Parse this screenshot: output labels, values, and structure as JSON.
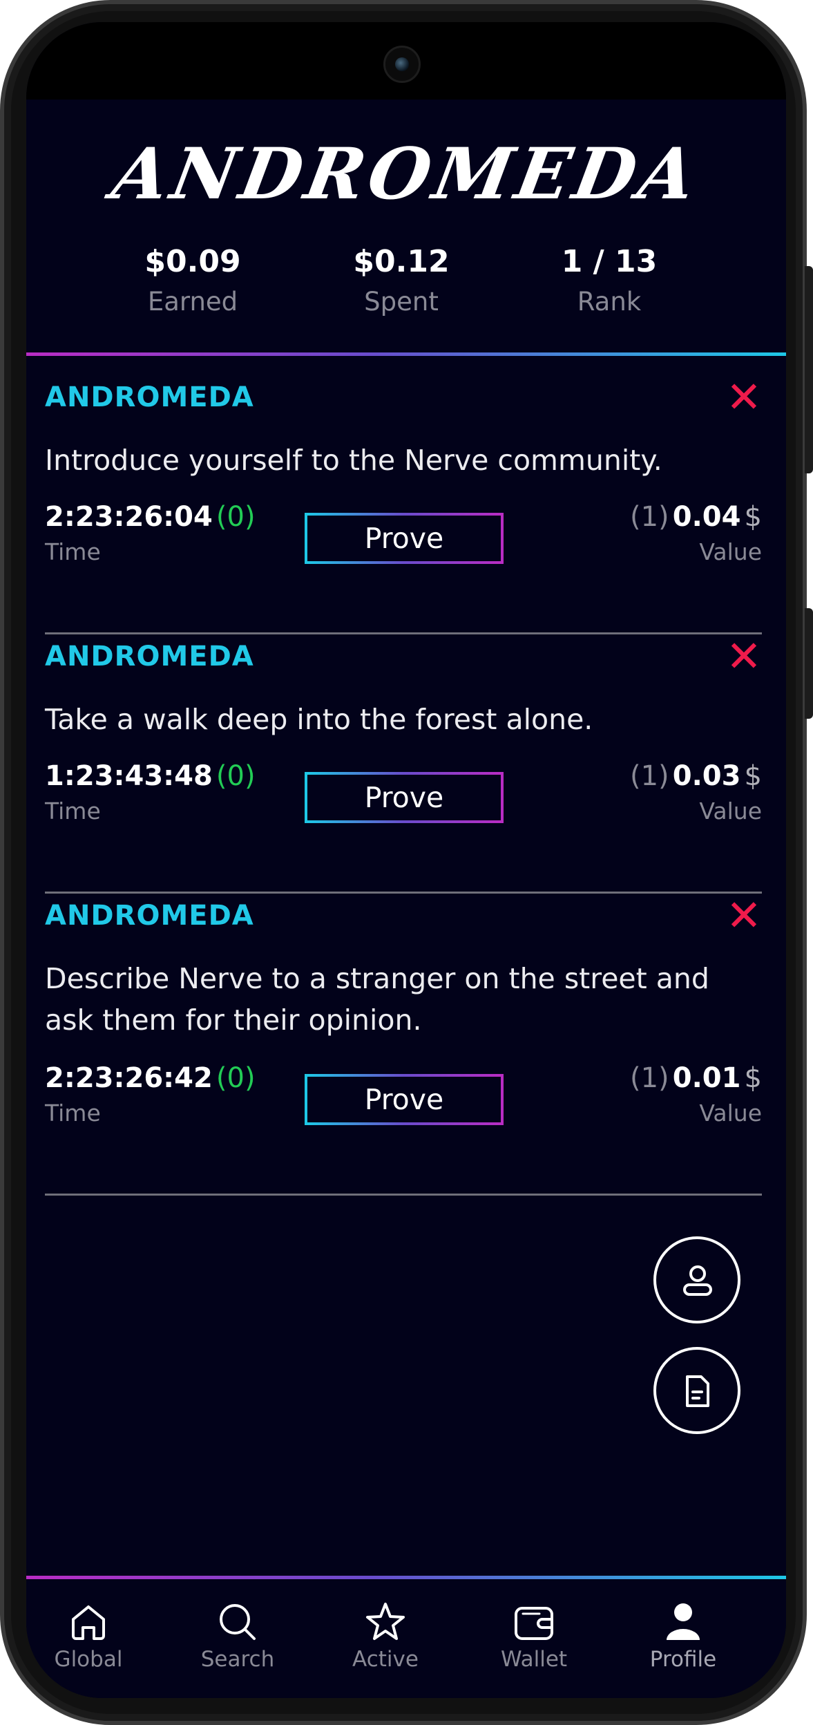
{
  "header": {
    "logo_text": "ANDROMEDA",
    "stats": [
      {
        "value": "$0.09",
        "label": "Earned"
      },
      {
        "value": "$0.12",
        "label": "Spent"
      },
      {
        "value": "1 / 13",
        "label": "Rank"
      }
    ]
  },
  "tasks": [
    {
      "author": "ANDROMEDA",
      "close_symbol": "✕",
      "description": "Introduce yourself to the Nerve community.",
      "time": "2:23:26:04",
      "time_count": "(0)",
      "time_label": "Time",
      "prove_label": "Prove",
      "value_count": "(1)",
      "value_amount": "0.04",
      "currency": "$",
      "value_label": "Value"
    },
    {
      "author": "ANDROMEDA",
      "close_symbol": "✕",
      "description": "Take a walk deep into the forest alone.",
      "time": "1:23:43:48",
      "time_count": "(0)",
      "time_label": "Time",
      "prove_label": "Prove",
      "value_count": "(1)",
      "value_amount": "0.03",
      "currency": "$",
      "value_label": "Value"
    },
    {
      "author": "ANDROMEDA",
      "close_symbol": "✕",
      "description": "Describe Nerve to a stranger on the street and ask them for their opinion.",
      "time": "2:23:26:42",
      "time_count": "(0)",
      "time_label": "Time",
      "prove_label": "Prove",
      "value_count": "(1)",
      "value_amount": "0.01",
      "currency": "$",
      "value_label": "Value"
    }
  ],
  "fabs": [
    {
      "icon": "user-icon"
    },
    {
      "icon": "document-icon"
    }
  ],
  "nav": [
    {
      "label": "Global",
      "icon": "home-icon"
    },
    {
      "label": "Search",
      "icon": "search-icon"
    },
    {
      "label": "Active",
      "icon": "star-icon"
    },
    {
      "label": "Wallet",
      "icon": "wallet-icon"
    },
    {
      "label": "Profile",
      "icon": "profile-icon",
      "active": true
    }
  ],
  "colors": {
    "background": "#02021a",
    "accent_cyan": "#21c9e8",
    "accent_magenta": "#b92cc4",
    "close_red": "#ef1b4b",
    "count_green": "#22cc55"
  }
}
